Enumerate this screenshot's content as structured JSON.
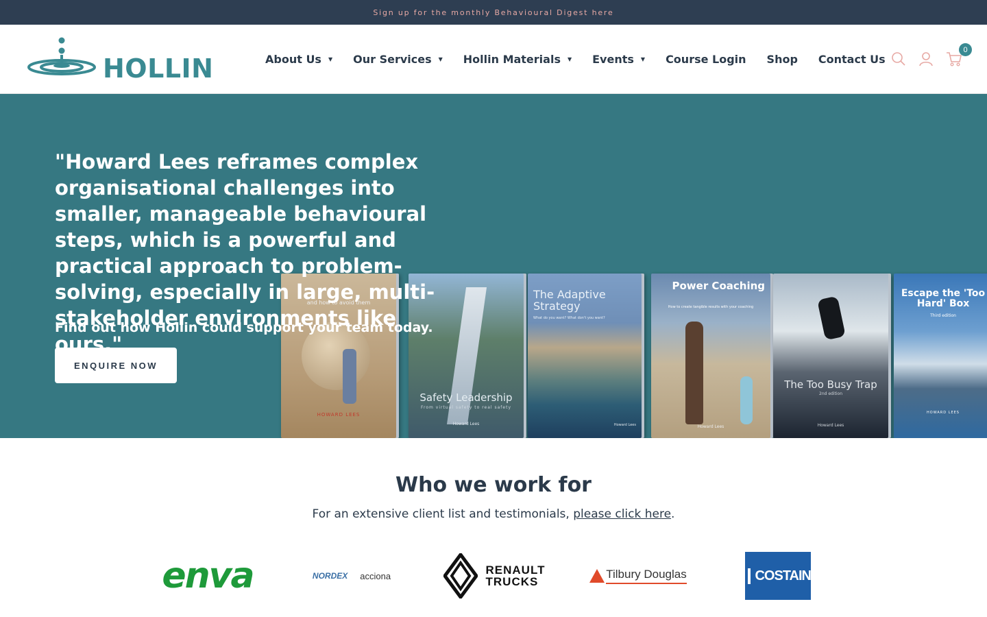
{
  "announcement": "Sign up for the monthly Behavioural Digest here",
  "brand": {
    "name": "HOLLIN",
    "color": "#3a8a92"
  },
  "nav": [
    {
      "label": "About Us",
      "dropdown": true
    },
    {
      "label": "Our Services",
      "dropdown": true
    },
    {
      "label": "Hollin Materials",
      "dropdown": true
    },
    {
      "label": "Events",
      "dropdown": true
    },
    {
      "label": "Course Login",
      "dropdown": false
    },
    {
      "label": "Shop",
      "dropdown": false
    },
    {
      "label": "Contact Us",
      "dropdown": false
    }
  ],
  "header_icons": {
    "search": "search-icon",
    "account": "user-icon",
    "cart": "cart-icon",
    "cart_count": "0"
  },
  "hero": {
    "quote": "\"Howard Lees reframes complex organisational challenges into smaller, manageable behavioural steps, which is a powerful and practical approach to problem-solving, especially in large, multi-stakeholder environments like ours.\"",
    "subtitle": "Find out how Hollin could support your team today.",
    "cta": "ENQUIRE NOW",
    "books": [
      {
        "title": "",
        "author": "HOWARD LEES",
        "tagline": "and how to avoid them"
      },
      {
        "title": "Safety Leadership",
        "author": "Howard Lees",
        "tagline": "From virtual safety to real safety"
      },
      {
        "title": "The Adaptive Strategy",
        "author": "Howard Lees",
        "tagline": "What do you want? What don't you want?"
      },
      {
        "title": "Power Coaching",
        "author": "Howard Lees",
        "tagline": "How to create tangible results with your coaching"
      },
      {
        "title": "The Too Busy Trap",
        "author": "Howard Lees",
        "tagline": "2nd edition"
      },
      {
        "title": "Escape the 'Too Hard' Box",
        "author": "HOWARD LEES",
        "tagline": "Third edition"
      }
    ],
    "bg_color": "#367882"
  },
  "clients": {
    "heading": "Who we work for",
    "intro_before": "For an extensive client list and testimonials, ",
    "intro_link": "please click here",
    "intro_after": ".",
    "logos": [
      "enva",
      "NORDEX",
      "acciona",
      "RENAULT",
      "TRUCKS",
      "Tilbury Douglas",
      "COSTAIN"
    ]
  }
}
